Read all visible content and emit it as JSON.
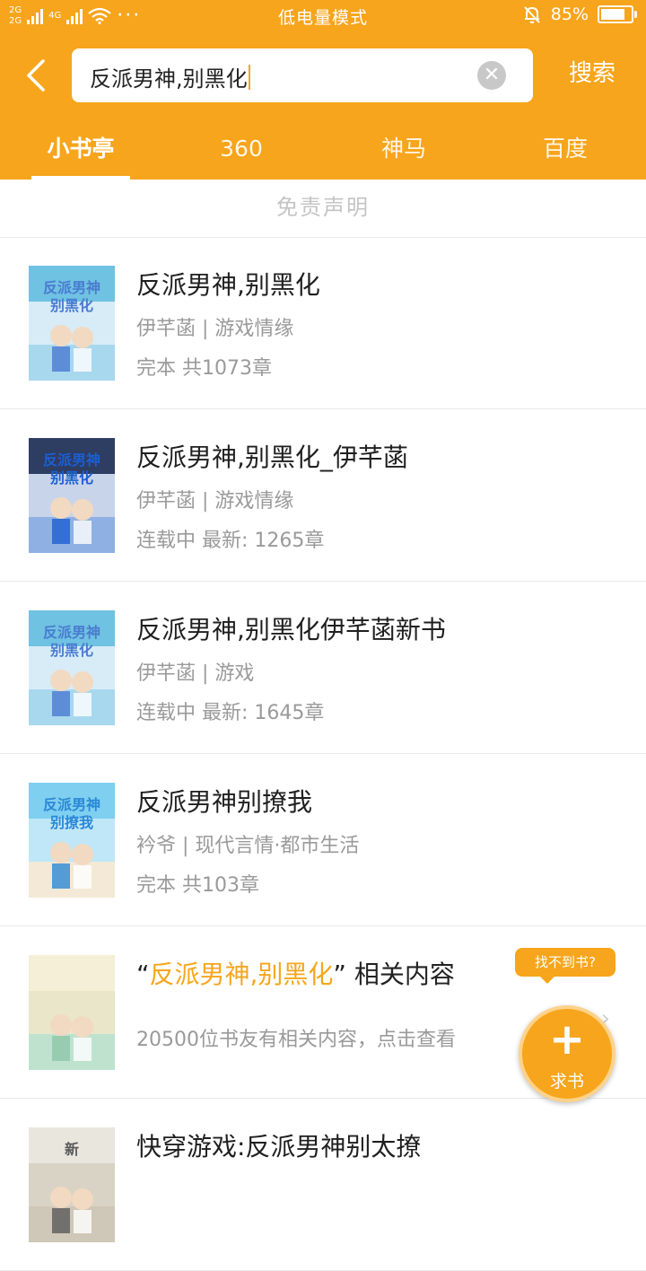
{
  "status_bar": {
    "sig1": "2G",
    "sig2": "4G",
    "sig3": "2G",
    "more": "···",
    "mode": "低电量模式",
    "battery": "85%"
  },
  "search": {
    "query": "反派男神,别黑化",
    "button": "搜索"
  },
  "tabs": [
    "小书亭",
    "360",
    "神马",
    "百度"
  ],
  "disclaimer": "免责声明",
  "results": [
    {
      "title": "反派男神,别黑化",
      "meta1": "伊芊菡 | 游戏情缘",
      "meta2": "完本 共1073章",
      "cover": {
        "top": "#6fc2e2",
        "mid": "#d7ecf7",
        "bottom": "#a8d8ee",
        "text": "反派男神 别黑化",
        "accent": "#4a7bd1"
      }
    },
    {
      "title": "反派男神,别黑化_伊芊菡",
      "meta1": "伊芊菡 | 游戏情缘",
      "meta2": "连载中 最新: 1265章",
      "cover": {
        "top": "#2e3d62",
        "mid": "#c8d4ea",
        "bottom": "#8fb0e2",
        "text": "反派男神 别黑化",
        "accent": "#1b5fd1"
      }
    },
    {
      "title": "反派男神,别黑化伊芊菡新书",
      "meta1": "伊芊菡 | 游戏",
      "meta2": "连载中 最新: 1645章",
      "cover": {
        "top": "#6fc2e2",
        "mid": "#d7ecf7",
        "bottom": "#a8d8ee",
        "text": "反派男神 别黑化",
        "accent": "#4a7bd1"
      }
    },
    {
      "title": "反派男神别撩我",
      "meta1": "衿爷 | 现代言情·都市生活",
      "meta2": "完本 共103章",
      "cover": {
        "top": "#7fcff0",
        "mid": "#bfe7f7",
        "bottom": "#f3e9d6",
        "text": "反派男神 别撩我",
        "accent": "#2a88d6"
      }
    },
    {
      "title_prefix": "“",
      "title_highlight": "反派男神,别黑化",
      "title_suffix": "” 相关内容",
      "meta1": "20500位书友有相关内容，点击查看",
      "cover": {
        "top": "#f4efd6",
        "mid": "#eae6c9",
        "bottom": "#bfe2cf",
        "text": "",
        "accent": "#8fc7a8"
      }
    },
    {
      "title": "快穿游戏:反派男神别太撩",
      "cover": {
        "top": "#e9e6de",
        "mid": "#d9d3c5",
        "bottom": "#cfc7b7",
        "text": "新",
        "accent": "#5a5a5a"
      }
    }
  ],
  "fab": {
    "tooltip": "找不到书?",
    "icon": "plus-icon",
    "label": "求书"
  },
  "colors": {
    "accent": "#F7A51C",
    "title": "#1f1f1f",
    "meta": "#9a9a9a",
    "divider": "#e8e8e8"
  }
}
